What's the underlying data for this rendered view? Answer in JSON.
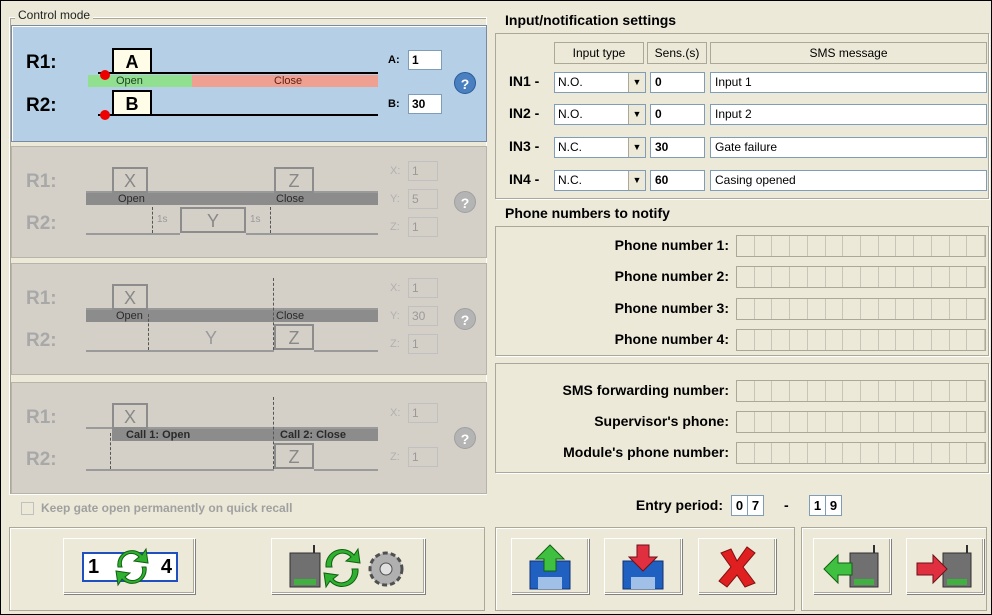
{
  "control_mode": {
    "legend": "Control mode",
    "mode1": {
      "r1": "R1:",
      "r2": "R2:",
      "box_a": "A",
      "box_b": "B",
      "open": "Open",
      "close": "Close",
      "field_a_label": "A:",
      "field_a_value": "1",
      "field_b_label": "B:",
      "field_b_value": "30",
      "help": "?"
    },
    "mode2": {
      "r1": "R1:",
      "r2": "R2:",
      "box_x": "X",
      "box_z": "Z",
      "box_y": "Y",
      "open": "Open",
      "close": "Close",
      "delay1": "1s",
      "delay2": "1s",
      "field_x_label": "X:",
      "field_x_value": "1",
      "field_y_label": "Y:",
      "field_y_value": "5",
      "field_z_label": "Z:",
      "field_z_value": "1",
      "help": "?"
    },
    "mode3": {
      "r1": "R1:",
      "r2": "R2:",
      "box_x": "X",
      "box_z": "Z",
      "label_y": "Y",
      "open": "Open",
      "close": "Close",
      "field_x_label": "X:",
      "field_x_value": "1",
      "field_y_label": "Y:",
      "field_y_value": "30",
      "field_z_label": "Z:",
      "field_z_value": "1",
      "help": "?"
    },
    "mode4": {
      "r1": "R1:",
      "r2": "R2:",
      "box_x": "X",
      "box_z": "Z",
      "call1": "Call 1: Open",
      "call2": "Call 2: Close",
      "field_x_label": "X:",
      "field_x_value": "1",
      "field_z_label": "Z:",
      "field_z_value": "1",
      "help": "?"
    },
    "keep_open_label": "Keep gate open permanently on quick recall"
  },
  "input_settings": {
    "title": "Input/notification settings",
    "headers": [
      "Input type",
      "Sens.(s)",
      "SMS message"
    ],
    "rows": [
      {
        "label": "IN1 -",
        "type": "N.O.",
        "sens": "0",
        "sms": "Input 1"
      },
      {
        "label": "IN2 -",
        "type": "N.O.",
        "sens": "0",
        "sms": "Input 2"
      },
      {
        "label": "IN3 -",
        "type": "N.C.",
        "sens": "30",
        "sms": "Gate failure"
      },
      {
        "label": "IN4 -",
        "type": "N.C.",
        "sens": "60",
        "sms": "Casing opened"
      }
    ]
  },
  "phones": {
    "title": "Phone numbers to notify",
    "labels": [
      "Phone number 1:",
      "Phone number 2:",
      "Phone number 3:",
      "Phone number 4:"
    ],
    "sms_forwarding": "SMS forwarding number:",
    "supervisor": "Supervisor's phone:",
    "module": "Module's phone number:"
  },
  "entry_period": {
    "label": "Entry period:",
    "from": [
      "0",
      "7"
    ],
    "sep": "-",
    "to": [
      "1",
      "9"
    ]
  },
  "toolbar": {
    "sequence_text": "1 ",
    "sequence_end": "4"
  },
  "icons": [
    "sequence-refresh-icon",
    "device-sync-gear-icon",
    "upload-disk-icon",
    "download-disk-icon",
    "cancel-x-icon",
    "device-import-icon",
    "device-export-icon",
    "help-icon",
    "dropdown-arrow-icon"
  ]
}
